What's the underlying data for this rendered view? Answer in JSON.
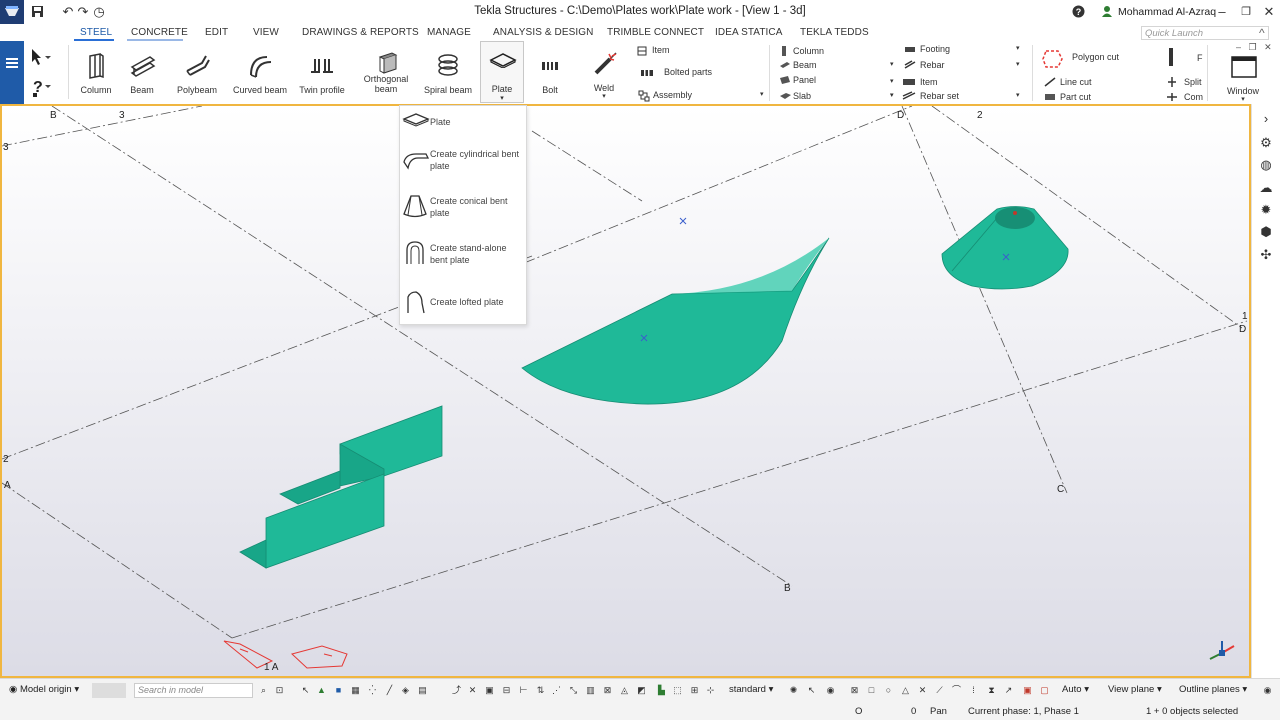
{
  "window": {
    "title": "Tekla Structures - C:\\Demo\\Plates work\\Plate work  - [View 1 - 3d]",
    "user": "Mohammad Al-Azraq"
  },
  "tabs": [
    {
      "label": "STEEL",
      "active": true
    },
    {
      "label": "CONCRETE",
      "active": false
    },
    {
      "label": "EDIT",
      "active": false
    },
    {
      "label": "VIEW",
      "active": false
    },
    {
      "label": "DRAWINGS & REPORTS",
      "active": false
    },
    {
      "label": "MANAGE",
      "active": false
    },
    {
      "label": "ANALYSIS & DESIGN",
      "active": false
    },
    {
      "label": "TRIMBLE CONNECT",
      "active": false
    },
    {
      "label": "IDEA STATICA",
      "active": false
    },
    {
      "label": "TEKLA TEDDS",
      "active": false
    }
  ],
  "quick_launch_placeholder": "Quick Launch",
  "ribbon": {
    "buttons": [
      "Column",
      "Beam",
      "Polybeam",
      "Curved beam",
      "Twin profile",
      "Orthogonal beam",
      "Spiral beam",
      "Plate",
      "Bolt",
      "Weld"
    ],
    "parts": {
      "item": "Item",
      "bolted_parts": "Bolted parts",
      "assembly": "Assembly"
    },
    "concrete": {
      "column": "Column",
      "beam": "Beam",
      "panel": "Panel",
      "slab": "Slab"
    },
    "rebar": {
      "footing": "Footing",
      "rebar": "Rebar",
      "item": "Item",
      "rebar_set": "Rebar set"
    },
    "cuts": {
      "polygon_cut": "Polygon cut",
      "line_cut": "Line cut",
      "part_cut": "Part cut",
      "f": "F",
      "split": "Split",
      "com": "Com"
    },
    "window": "Window"
  },
  "plate_dropdown": [
    "Plate",
    "Create cylindrical bent plate",
    "Create conical bent plate",
    "Create stand-alone bent plate",
    "Create lofted plate"
  ],
  "grid_labels": {
    "b_top": "B",
    "three_top": "3",
    "d_top": "D",
    "two_top": "2",
    "three_left": "3",
    "two_left": "2",
    "a_left": "A",
    "one_right": "1",
    "d_right": "D",
    "c_lower": "C",
    "b_lower": "B",
    "one_a": "1 A"
  },
  "bottom_toolbar": {
    "model_origin": "Model origin",
    "search_placeholder": "Search in model",
    "standard": "standard",
    "auto": "Auto",
    "view_plane": "View plane",
    "outline_planes": "Outline planes"
  },
  "status": {
    "o_label": "O",
    "zero": "0",
    "pan": "Pan",
    "phase": "Current phase: 1, Phase 1",
    "selection": "1 + 0 objects selected"
  },
  "colors": {
    "accent": "#1f5ba8",
    "plate": "#1fb998",
    "viewport_border": "#f0b640"
  }
}
